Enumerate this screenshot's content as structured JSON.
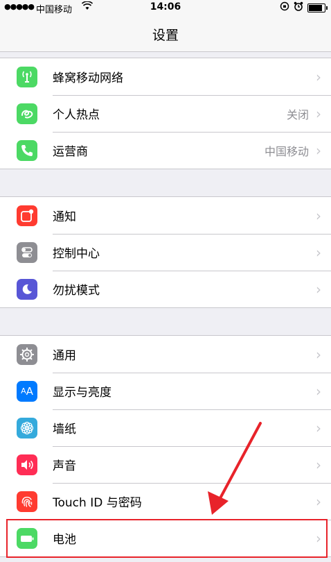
{
  "status_bar": {
    "signal": "●●●●●",
    "carrier": "中国移动",
    "time": "14:06"
  },
  "nav": {
    "title": "设置"
  },
  "groups": [
    {
      "items": [
        {
          "label": "蜂窝移动网络",
          "detail": "",
          "icon": "cellular-icon",
          "color": "#4cd964"
        },
        {
          "label": "个人热点",
          "detail": "关闭",
          "icon": "hotspot-icon",
          "color": "#4cd964"
        },
        {
          "label": "运营商",
          "detail": "中国移动",
          "icon": "phone-icon",
          "color": "#4cd964"
        }
      ]
    },
    {
      "items": [
        {
          "label": "通知",
          "detail": "",
          "icon": "notifications-icon",
          "color": "#ff3b30"
        },
        {
          "label": "控制中心",
          "detail": "",
          "icon": "control-center-icon",
          "color": "#8e8e93"
        },
        {
          "label": "勿扰模式",
          "detail": "",
          "icon": "moon-icon",
          "color": "#5856d6"
        }
      ]
    },
    {
      "items": [
        {
          "label": "通用",
          "detail": "",
          "icon": "gear-icon",
          "color": "#8e8e93"
        },
        {
          "label": "显示与亮度",
          "detail": "",
          "icon": "display-icon",
          "color": "#007aff"
        },
        {
          "label": "墙纸",
          "detail": "",
          "icon": "wallpaper-icon",
          "color": "#34aadc"
        },
        {
          "label": "声音",
          "detail": "",
          "icon": "sound-icon",
          "color": "#ff2d55"
        },
        {
          "label": "Touch ID 与密码",
          "detail": "",
          "icon": "fingerprint-icon",
          "color": "#ff3b30"
        },
        {
          "label": "电池",
          "detail": "",
          "icon": "battery-icon",
          "color": "#4cd964"
        }
      ]
    }
  ],
  "annotation": {
    "highlight_color": "#e8232a"
  }
}
